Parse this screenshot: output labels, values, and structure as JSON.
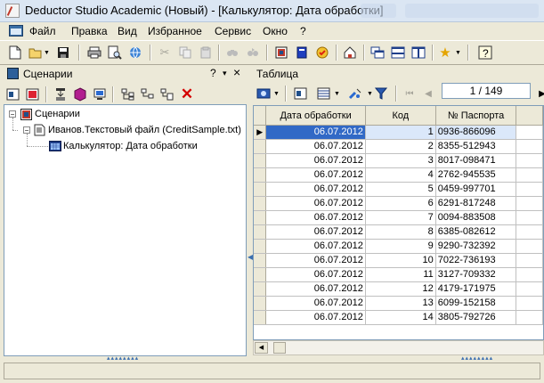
{
  "window": {
    "title": "Deductor Studio Academic (Новый) - [Калькулятор: Дата обработки]"
  },
  "menu": {
    "items": [
      "Файл",
      "Правка",
      "Вид",
      "Избранное",
      "Сервис",
      "Окно",
      "?"
    ]
  },
  "toolbar_icons": [
    "new-file-icon",
    "open-folder-icon",
    "save-icon",
    "print-icon",
    "print-preview-icon",
    "internet-icon",
    "cut-icon",
    "copy-icon",
    "paste-icon",
    "find-icon",
    "find-next-icon",
    "scenario-icon",
    "book-icon",
    "wizard-icon",
    "home-icon",
    "windows-cascade-icon",
    "windows-horizontal-icon",
    "windows-vertical-icon",
    "favorites-star-icon",
    "help-icon"
  ],
  "left_panel": {
    "title": "Сценарии",
    "help": "?",
    "pin": "▾",
    "close": "×",
    "tree": {
      "root": "Сценарии",
      "child": "Иванов.Текстовый файл (CreditSample.txt)",
      "grandchild": "Калькулятор: Дата обработки"
    }
  },
  "right_panel": {
    "title": "Таблица",
    "record_nav": "1 / 149",
    "columns": [
      "Дата обработки",
      "Код",
      "№ Паспорта"
    ],
    "rows": [
      [
        "06.07.2012",
        "1",
        "0936-866096"
      ],
      [
        "06.07.2012",
        "2",
        "8355-512943"
      ],
      [
        "06.07.2012",
        "3",
        "8017-098471"
      ],
      [
        "06.07.2012",
        "4",
        "2762-945535"
      ],
      [
        "06.07.2012",
        "5",
        "0459-997701"
      ],
      [
        "06.07.2012",
        "6",
        "6291-817248"
      ],
      [
        "06.07.2012",
        "7",
        "0094-883508"
      ],
      [
        "06.07.2012",
        "8",
        "6385-082612"
      ],
      [
        "06.07.2012",
        "9",
        "9290-732392"
      ],
      [
        "06.07.2012",
        "10",
        "7022-736193"
      ],
      [
        "06.07.2012",
        "11",
        "3127-709332"
      ],
      [
        "06.07.2012",
        "12",
        "4179-171975"
      ],
      [
        "06.07.2012",
        "13",
        "6099-152158"
      ],
      [
        "06.07.2012",
        "14",
        "3805-792726"
      ]
    ]
  },
  "colors": {
    "selection": "#3169c6",
    "accent": "#3b6fb0",
    "face": "#ece9d8"
  }
}
